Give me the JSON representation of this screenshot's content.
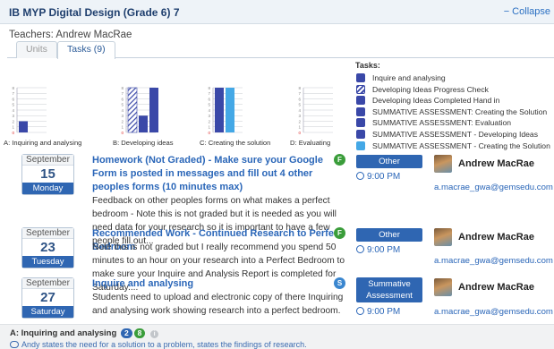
{
  "course": {
    "title": "IB MYP Digital Design (Grade 6) 7",
    "collapse_label": "− Collapse"
  },
  "teachers_line": "Teachers: Andrew MacRae",
  "tabs": [
    {
      "label": "Units"
    },
    {
      "label": "Tasks (9)"
    }
  ],
  "legend": {
    "title": "Tasks:",
    "items": [
      {
        "label": "Inquire and analysing",
        "color": "#3a48a8",
        "hatched": false
      },
      {
        "label": "Developing Ideas Progress Check",
        "color": "#3a48a8",
        "hatched": true
      },
      {
        "label": "Developing Ideas Completed Hand in",
        "color": "#3a48a8",
        "hatched": false
      },
      {
        "label": "SUMMATIVE ASSESSMENT: Creating the Solution",
        "color": "#3a48a8",
        "hatched": false
      },
      {
        "label": "SUMMATIVE ASSESSMENT: Evaluation",
        "color": "#3a48a8",
        "hatched": false
      },
      {
        "label": "SUMMATIVE ASSESSMENT - Developing Ideas",
        "color": "#3a48a8",
        "hatched": false
      },
      {
        "label": "SUMMATIVE ASSESSMENT - Creating the Solution",
        "color": "#44a8e6",
        "hatched": false
      }
    ]
  },
  "chart_data": {
    "type": "bar",
    "ylim": [
      0,
      8
    ],
    "yticks": [
      "0",
      "1",
      "2",
      "3",
      "4",
      "5",
      "6",
      "7",
      "8"
    ],
    "groups": [
      {
        "label": "A: Inquiring and analysing",
        "bars": [
          {
            "value": 2,
            "color": "#3a48a8",
            "hatched": false
          }
        ]
      },
      {
        "label": "B: Developing ideas",
        "bars": [
          {
            "value": 8,
            "color": "#3a48a8",
            "hatched": true
          },
          {
            "value": 3,
            "color": "#3a48a8",
            "hatched": false
          },
          {
            "value": 8,
            "color": "#3a48a8",
            "hatched": false
          }
        ]
      },
      {
        "label": "C: Creating the solution",
        "bars": [
          {
            "value": 8,
            "color": "#3a48a8",
            "hatched": false
          },
          {
            "value": 8,
            "color": "#44a8e6",
            "hatched": false
          }
        ]
      },
      {
        "label": "D: Evaluating",
        "bars": []
      }
    ]
  },
  "tasks": [
    {
      "month": "September",
      "day": "15",
      "weekday": "Monday",
      "title": "Homework (Not Graded) - Make sure your Google Form is posted in messages and fill out 4 other peoples forms (10 minutes max)",
      "description": "Feedback on other peoples forms on what makes a perfect bedroom - Note this is not graded but it is needed as you will need data for your research so it is important to have a few people fill out...",
      "badge": "F",
      "type": "Other",
      "due": "9:00 PM",
      "teacher": "Andrew MacRae",
      "email": "a.macrae_gwa@gemsedu.com"
    },
    {
      "month": "September",
      "day": "23",
      "weekday": "Tuesday",
      "title": "Recommended Work - Continued Research to Perfect Bedroom",
      "description": "Note this is not graded but I really recommend you spend 50 minutes to an hour on your research into a Perfect Bedroom to make sure your Inquire and Analysis Report is completed for Saturday....",
      "badge": "F",
      "type": "Other",
      "due": "9:00 PM",
      "teacher": "Andrew MacRae",
      "email": "a.macrae_gwa@gemsedu.com"
    },
    {
      "month": "September",
      "day": "27",
      "weekday": "Saturday",
      "title": "Inquire and analysing",
      "description": "Students need to upload and electronic copy of there Inquiring and analysing work showing research into a perfect bedroom.",
      "badge": "S",
      "type": "Summative Assessment",
      "due": "9:00 PM",
      "teacher": "Andrew MacRae",
      "email": "a.macrae_gwa@gemsedu.com"
    }
  ],
  "criterion": {
    "label": "A: Inquiring and analysing",
    "count1": "2",
    "count2": "8",
    "description": "Andy states the need for a solution to a problem, states the findings of research."
  }
}
